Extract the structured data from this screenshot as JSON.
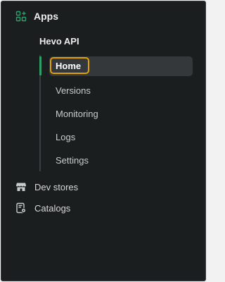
{
  "nav": {
    "apps_label": "Apps",
    "app_name": "Hevo API",
    "sub_items": [
      "Home",
      "Versions",
      "Monitoring",
      "Logs",
      "Settings"
    ],
    "active_item": "Home",
    "dev_stores_label": "Dev stores",
    "catalogs_label": "Catalogs"
  },
  "icons": {
    "apps": "apps-grid-plus-icon",
    "dev_stores": "store-icon",
    "catalogs": "catalog-icon"
  },
  "colors": {
    "background": "#1b1e1f",
    "active_indicator": "#2f9e6b",
    "focus_ring": "#e0a100",
    "active_bg": "#34383a"
  }
}
